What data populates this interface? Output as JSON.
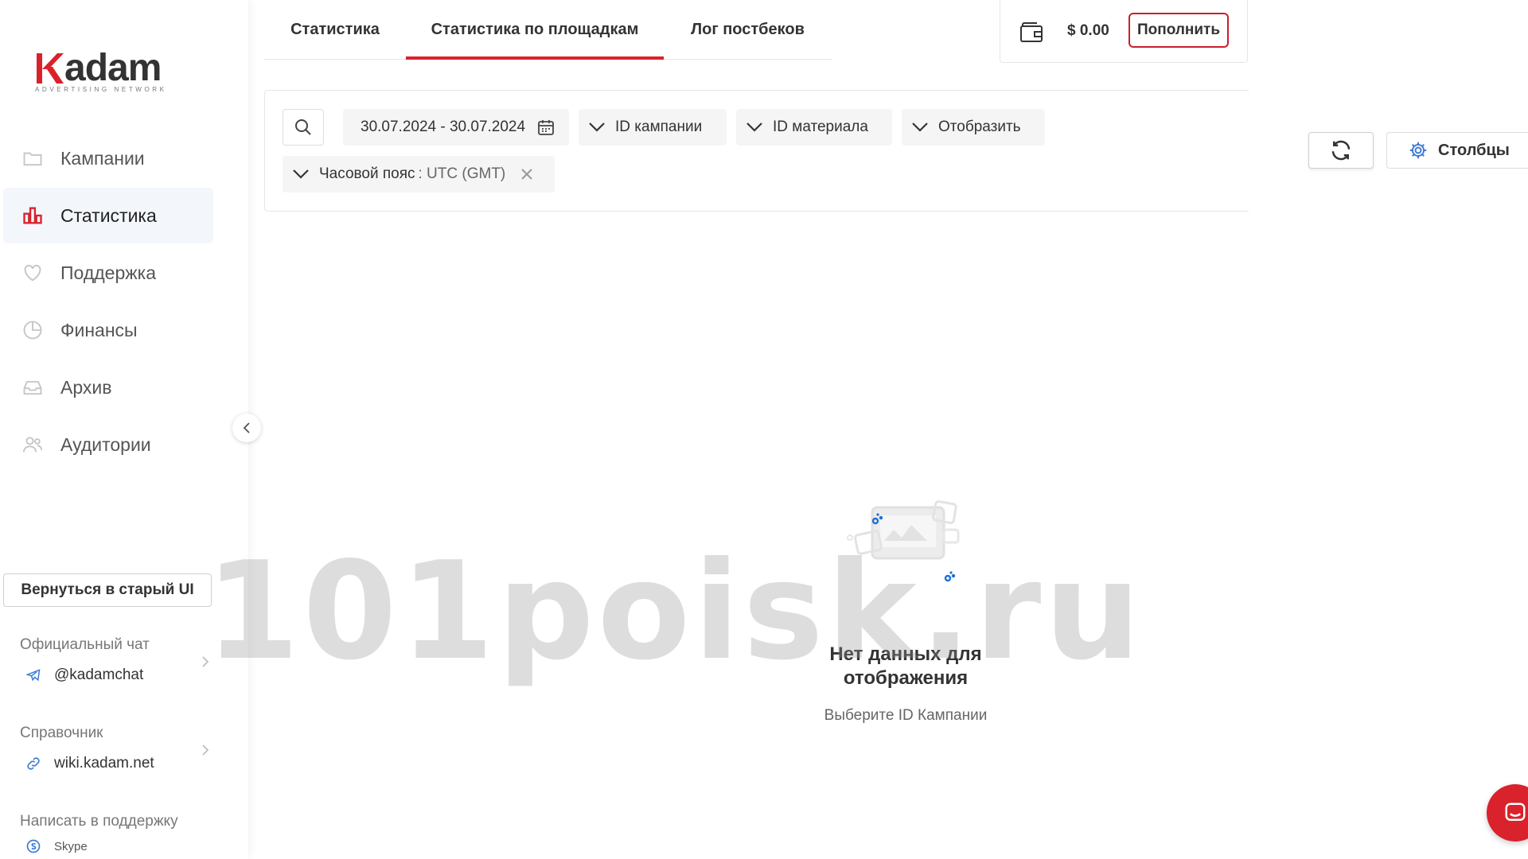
{
  "brand": {
    "name": "kadam",
    "tagline": "ADVERTISING NETWORK",
    "accent": "#d9222b"
  },
  "sidebar": {
    "items": [
      {
        "label": "Кампании",
        "icon": "folder-icon",
        "active": false
      },
      {
        "label": "Статистика",
        "icon": "bar-chart-icon",
        "active": true
      },
      {
        "label": "Поддержка",
        "icon": "heart-icon",
        "active": false
      },
      {
        "label": "Финансы",
        "icon": "pie-chart-icon",
        "active": false
      },
      {
        "label": "Архив",
        "icon": "inbox-icon",
        "active": false
      },
      {
        "label": "Аудитории",
        "icon": "users-icon",
        "active": false
      }
    ],
    "old_ui_label": "Вернуться в старый UI",
    "chat": {
      "label": "Официальный чат",
      "link": "@kadamchat",
      "icon": "telegram-icon"
    },
    "wiki": {
      "label": "Справочник",
      "link": "wiki.kadam.net",
      "icon": "link-icon"
    },
    "support": {
      "label": "Написать в поддержку",
      "link": "Skype",
      "icon": "skype-icon"
    }
  },
  "tabs": [
    {
      "label": "Статистика",
      "active": false
    },
    {
      "label": "Статистика по площадкам",
      "active": true
    },
    {
      "label": "Лог постбеков",
      "active": false
    }
  ],
  "balance": {
    "amount": "$ 0.00",
    "topup_label": "Пополнить"
  },
  "filters": {
    "date_range": "30.07.2024 - 30.07.2024",
    "campaign_id": "ID кампании",
    "material_id": "ID материала",
    "display": "Отобразить",
    "timezone_label": "Часовой пояс",
    "timezone_value": ": UTC (GMT)"
  },
  "toolbar": {
    "columns_label": "Столбцы"
  },
  "empty": {
    "title": "Нет данных для отображения",
    "subtitle": "Выберите ID Кампании"
  },
  "watermark": "101poisk.ru"
}
